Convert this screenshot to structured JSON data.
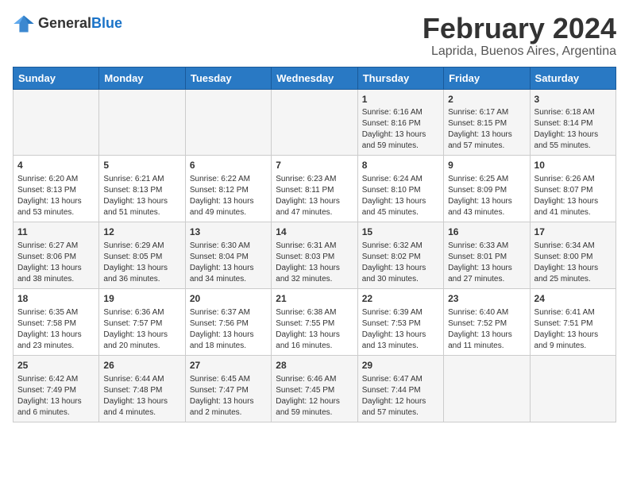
{
  "header": {
    "logo_general": "General",
    "logo_blue": "Blue",
    "title": "February 2024",
    "subtitle": "Laprida, Buenos Aires, Argentina"
  },
  "days_of_week": [
    "Sunday",
    "Monday",
    "Tuesday",
    "Wednesday",
    "Thursday",
    "Friday",
    "Saturday"
  ],
  "weeks": [
    [
      {
        "day": "",
        "info": ""
      },
      {
        "day": "",
        "info": ""
      },
      {
        "day": "",
        "info": ""
      },
      {
        "day": "",
        "info": ""
      },
      {
        "day": "1",
        "info": "Sunrise: 6:16 AM\nSunset: 8:16 PM\nDaylight: 13 hours\nand 59 minutes."
      },
      {
        "day": "2",
        "info": "Sunrise: 6:17 AM\nSunset: 8:15 PM\nDaylight: 13 hours\nand 57 minutes."
      },
      {
        "day": "3",
        "info": "Sunrise: 6:18 AM\nSunset: 8:14 PM\nDaylight: 13 hours\nand 55 minutes."
      }
    ],
    [
      {
        "day": "4",
        "info": "Sunrise: 6:20 AM\nSunset: 8:13 PM\nDaylight: 13 hours\nand 53 minutes."
      },
      {
        "day": "5",
        "info": "Sunrise: 6:21 AM\nSunset: 8:13 PM\nDaylight: 13 hours\nand 51 minutes."
      },
      {
        "day": "6",
        "info": "Sunrise: 6:22 AM\nSunset: 8:12 PM\nDaylight: 13 hours\nand 49 minutes."
      },
      {
        "day": "7",
        "info": "Sunrise: 6:23 AM\nSunset: 8:11 PM\nDaylight: 13 hours\nand 47 minutes."
      },
      {
        "day": "8",
        "info": "Sunrise: 6:24 AM\nSunset: 8:10 PM\nDaylight: 13 hours\nand 45 minutes."
      },
      {
        "day": "9",
        "info": "Sunrise: 6:25 AM\nSunset: 8:09 PM\nDaylight: 13 hours\nand 43 minutes."
      },
      {
        "day": "10",
        "info": "Sunrise: 6:26 AM\nSunset: 8:07 PM\nDaylight: 13 hours\nand 41 minutes."
      }
    ],
    [
      {
        "day": "11",
        "info": "Sunrise: 6:27 AM\nSunset: 8:06 PM\nDaylight: 13 hours\nand 38 minutes."
      },
      {
        "day": "12",
        "info": "Sunrise: 6:29 AM\nSunset: 8:05 PM\nDaylight: 13 hours\nand 36 minutes."
      },
      {
        "day": "13",
        "info": "Sunrise: 6:30 AM\nSunset: 8:04 PM\nDaylight: 13 hours\nand 34 minutes."
      },
      {
        "day": "14",
        "info": "Sunrise: 6:31 AM\nSunset: 8:03 PM\nDaylight: 13 hours\nand 32 minutes."
      },
      {
        "day": "15",
        "info": "Sunrise: 6:32 AM\nSunset: 8:02 PM\nDaylight: 13 hours\nand 30 minutes."
      },
      {
        "day": "16",
        "info": "Sunrise: 6:33 AM\nSunset: 8:01 PM\nDaylight: 13 hours\nand 27 minutes."
      },
      {
        "day": "17",
        "info": "Sunrise: 6:34 AM\nSunset: 8:00 PM\nDaylight: 13 hours\nand 25 minutes."
      }
    ],
    [
      {
        "day": "18",
        "info": "Sunrise: 6:35 AM\nSunset: 7:58 PM\nDaylight: 13 hours\nand 23 minutes."
      },
      {
        "day": "19",
        "info": "Sunrise: 6:36 AM\nSunset: 7:57 PM\nDaylight: 13 hours\nand 20 minutes."
      },
      {
        "day": "20",
        "info": "Sunrise: 6:37 AM\nSunset: 7:56 PM\nDaylight: 13 hours\nand 18 minutes."
      },
      {
        "day": "21",
        "info": "Sunrise: 6:38 AM\nSunset: 7:55 PM\nDaylight: 13 hours\nand 16 minutes."
      },
      {
        "day": "22",
        "info": "Sunrise: 6:39 AM\nSunset: 7:53 PM\nDaylight: 13 hours\nand 13 minutes."
      },
      {
        "day": "23",
        "info": "Sunrise: 6:40 AM\nSunset: 7:52 PM\nDaylight: 13 hours\nand 11 minutes."
      },
      {
        "day": "24",
        "info": "Sunrise: 6:41 AM\nSunset: 7:51 PM\nDaylight: 13 hours\nand 9 minutes."
      }
    ],
    [
      {
        "day": "25",
        "info": "Sunrise: 6:42 AM\nSunset: 7:49 PM\nDaylight: 13 hours\nand 6 minutes."
      },
      {
        "day": "26",
        "info": "Sunrise: 6:44 AM\nSunset: 7:48 PM\nDaylight: 13 hours\nand 4 minutes."
      },
      {
        "day": "27",
        "info": "Sunrise: 6:45 AM\nSunset: 7:47 PM\nDaylight: 13 hours\nand 2 minutes."
      },
      {
        "day": "28",
        "info": "Sunrise: 6:46 AM\nSunset: 7:45 PM\nDaylight: 12 hours\nand 59 minutes."
      },
      {
        "day": "29",
        "info": "Sunrise: 6:47 AM\nSunset: 7:44 PM\nDaylight: 12 hours\nand 57 minutes."
      },
      {
        "day": "",
        "info": ""
      },
      {
        "day": "",
        "info": ""
      }
    ]
  ]
}
